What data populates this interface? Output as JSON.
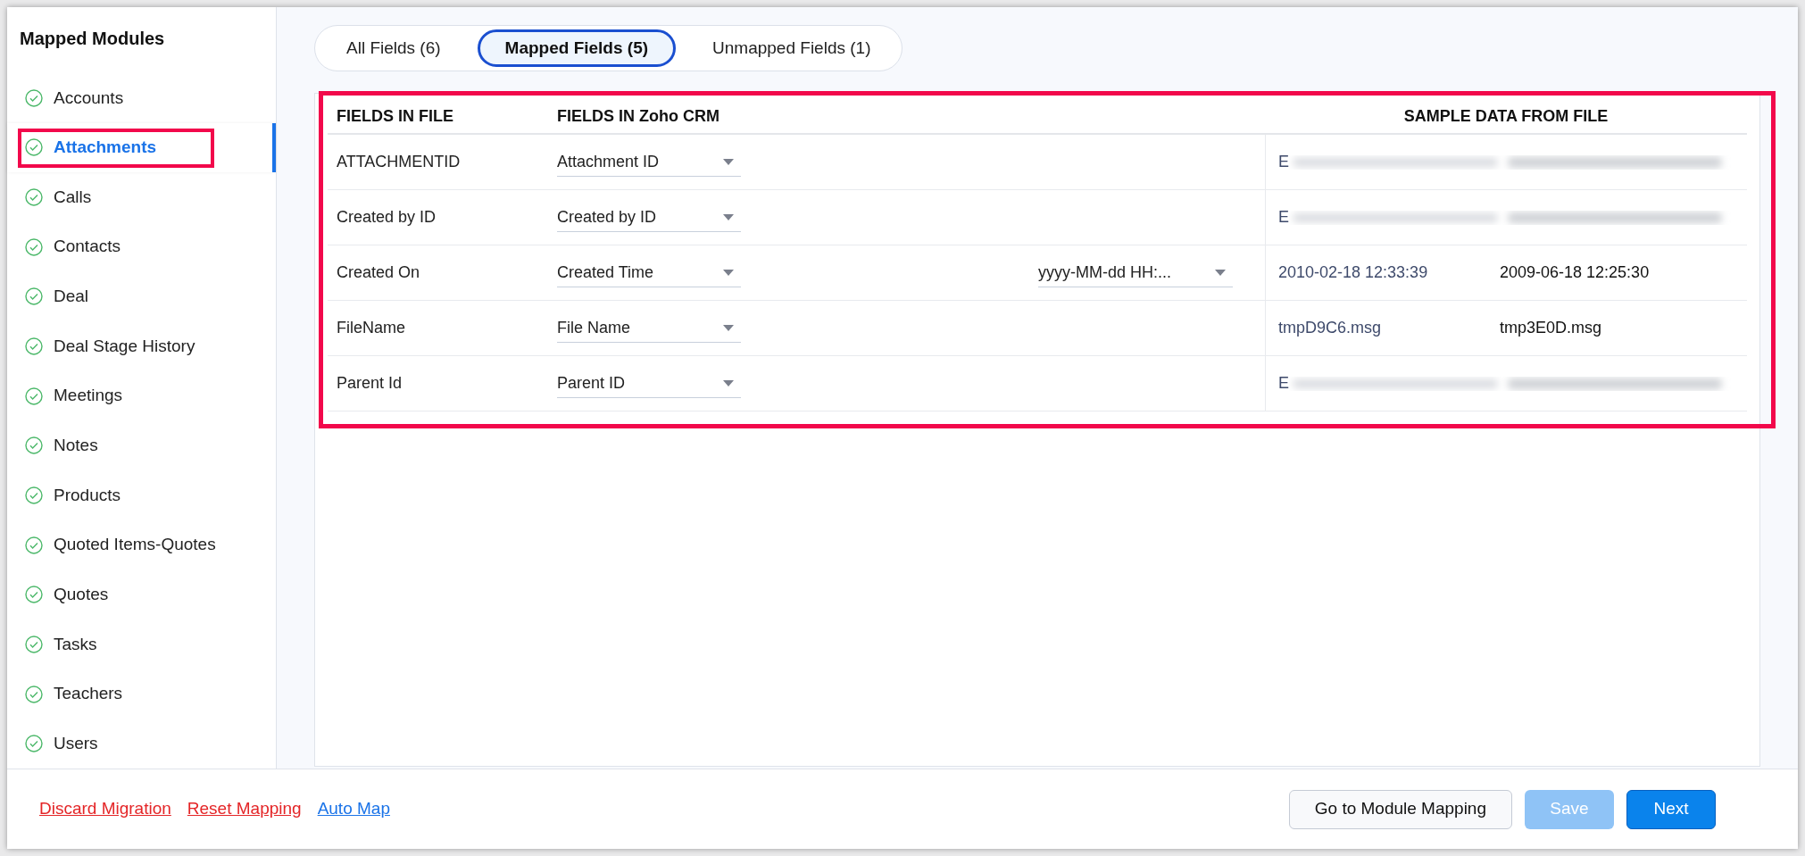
{
  "sidebar": {
    "title": "Mapped Modules",
    "items": [
      {
        "label": "Accounts",
        "selected": false,
        "highlighted": false
      },
      {
        "label": "Attachments",
        "selected": true,
        "highlighted": true
      },
      {
        "label": "Calls",
        "selected": false,
        "highlighted": false
      },
      {
        "label": "Contacts",
        "selected": false,
        "highlighted": false
      },
      {
        "label": "Deal",
        "selected": false,
        "highlighted": false
      },
      {
        "label": "Deal Stage History",
        "selected": false,
        "highlighted": false
      },
      {
        "label": "Meetings",
        "selected": false,
        "highlighted": false
      },
      {
        "label": "Notes",
        "selected": false,
        "highlighted": false
      },
      {
        "label": "Products",
        "selected": false,
        "highlighted": false
      },
      {
        "label": "Quoted Items-Quotes",
        "selected": false,
        "highlighted": false
      },
      {
        "label": "Quotes",
        "selected": false,
        "highlighted": false
      },
      {
        "label": "Tasks",
        "selected": false,
        "highlighted": false
      },
      {
        "label": "Teachers",
        "selected": false,
        "highlighted": false
      },
      {
        "label": "Users",
        "selected": false,
        "highlighted": false
      }
    ]
  },
  "tabs": [
    {
      "label": "All Fields (6)",
      "selected": false
    },
    {
      "label": "Mapped Fields (5)",
      "selected": true
    },
    {
      "label": "Unmapped Fields (1)",
      "selected": false
    }
  ],
  "table": {
    "highlighted": true,
    "columns": [
      "FIELDS IN FILE",
      "FIELDS IN Zoho CRM",
      "SAMPLE DATA FROM FILE"
    ],
    "rows": [
      {
        "file_field": "ATTACHMENTID",
        "crm_field": "Attachment ID",
        "samples": [
          {
            "text": "E",
            "redacted": true
          }
        ]
      },
      {
        "file_field": "Created by ID",
        "crm_field": "Created by ID",
        "samples": [
          {
            "text": "E",
            "redacted": true
          }
        ]
      },
      {
        "file_field": "Created On",
        "crm_field": "Created Time",
        "format": "yyyy-MM-dd HH:...",
        "samples": [
          {
            "text": "2010-02-18 12:33:39",
            "redacted": false
          },
          {
            "text": "2009-06-18 12:25:30",
            "redacted": false
          }
        ]
      },
      {
        "file_field": "FileName",
        "crm_field": "File Name",
        "samples": [
          {
            "text": "tmpD9C6.msg",
            "redacted": false
          },
          {
            "text": "tmp3E0D.msg",
            "redacted": false
          }
        ]
      },
      {
        "file_field": "Parent Id",
        "crm_field": "Parent ID",
        "samples": [
          {
            "text": "E",
            "redacted": true
          }
        ]
      }
    ]
  },
  "footer": {
    "links": [
      {
        "label": "Discard Migration",
        "color": "#e42527"
      },
      {
        "label": "Reset Mapping",
        "color": "#e42527"
      },
      {
        "label": "Auto Map",
        "color": "#1a73e8"
      }
    ],
    "buttons": [
      {
        "label": "Go to Module Mapping",
        "kind": "secondary",
        "disabled": false
      },
      {
        "label": "Save",
        "kind": "primary",
        "disabled": true
      },
      {
        "label": "Next",
        "kind": "primary",
        "disabled": false
      }
    ]
  }
}
